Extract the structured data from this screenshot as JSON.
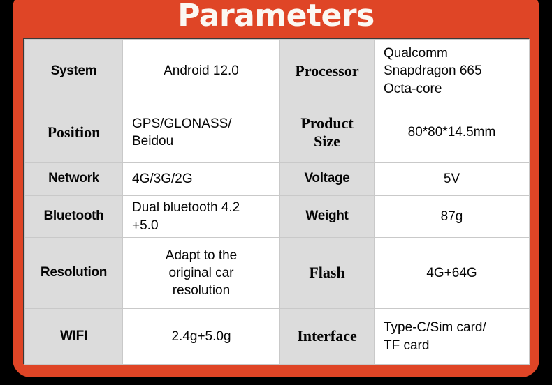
{
  "page": {
    "title": "Parameters",
    "frame_color": "#DF4526",
    "background_color": "#000000",
    "label_cell_color": "#DCDCDC",
    "value_cell_color": "#FFFFFF",
    "title_color": "#FBF8F3"
  },
  "table": {
    "rows": [
      {
        "left_label": "System",
        "left_label_style": "sans",
        "left_value": "Android 12.0",
        "left_value_align": "center",
        "right_label": "Processor",
        "right_label_style": "serif",
        "right_value": "Qualcomm\nSnapdragon 665\nOcta-core",
        "right_value_align": "left"
      },
      {
        "left_label": "Position",
        "left_label_style": "serif",
        "left_value": "GPS/GLONASS/\nBeidou",
        "left_value_align": "left",
        "right_label": "Product\nSize",
        "right_label_style": "serif",
        "right_value": "80*80*14.5mm",
        "right_value_align": "center"
      },
      {
        "left_label": "Network",
        "left_label_style": "sans",
        "left_value": "4G/3G/2G",
        "left_value_align": "left",
        "right_label": "Voltage",
        "right_label_style": "sans",
        "right_value": "5V",
        "right_value_align": "center"
      },
      {
        "left_label": "Bluetooth",
        "left_label_style": "sans",
        "left_value": "Dual bluetooth 4.2\n+5.0",
        "left_value_align": "left",
        "right_label": "Weight",
        "right_label_style": "sans",
        "right_value": "87g",
        "right_value_align": "center"
      },
      {
        "left_label": "Resolution",
        "left_label_style": "sans",
        "left_value": "Adapt to the\noriginal car\nresolution",
        "left_value_align": "center",
        "right_label": "Flash",
        "right_label_style": "serif",
        "right_value": "4G+64G",
        "right_value_align": "center"
      },
      {
        "left_label": "WIFI",
        "left_label_style": "sans",
        "left_value": "2.4g+5.0g",
        "left_value_align": "center",
        "right_label": "Interface",
        "right_label_style": "serif",
        "right_value": "Type-C/Sim card/\nTF card",
        "right_value_align": "left"
      }
    ]
  }
}
